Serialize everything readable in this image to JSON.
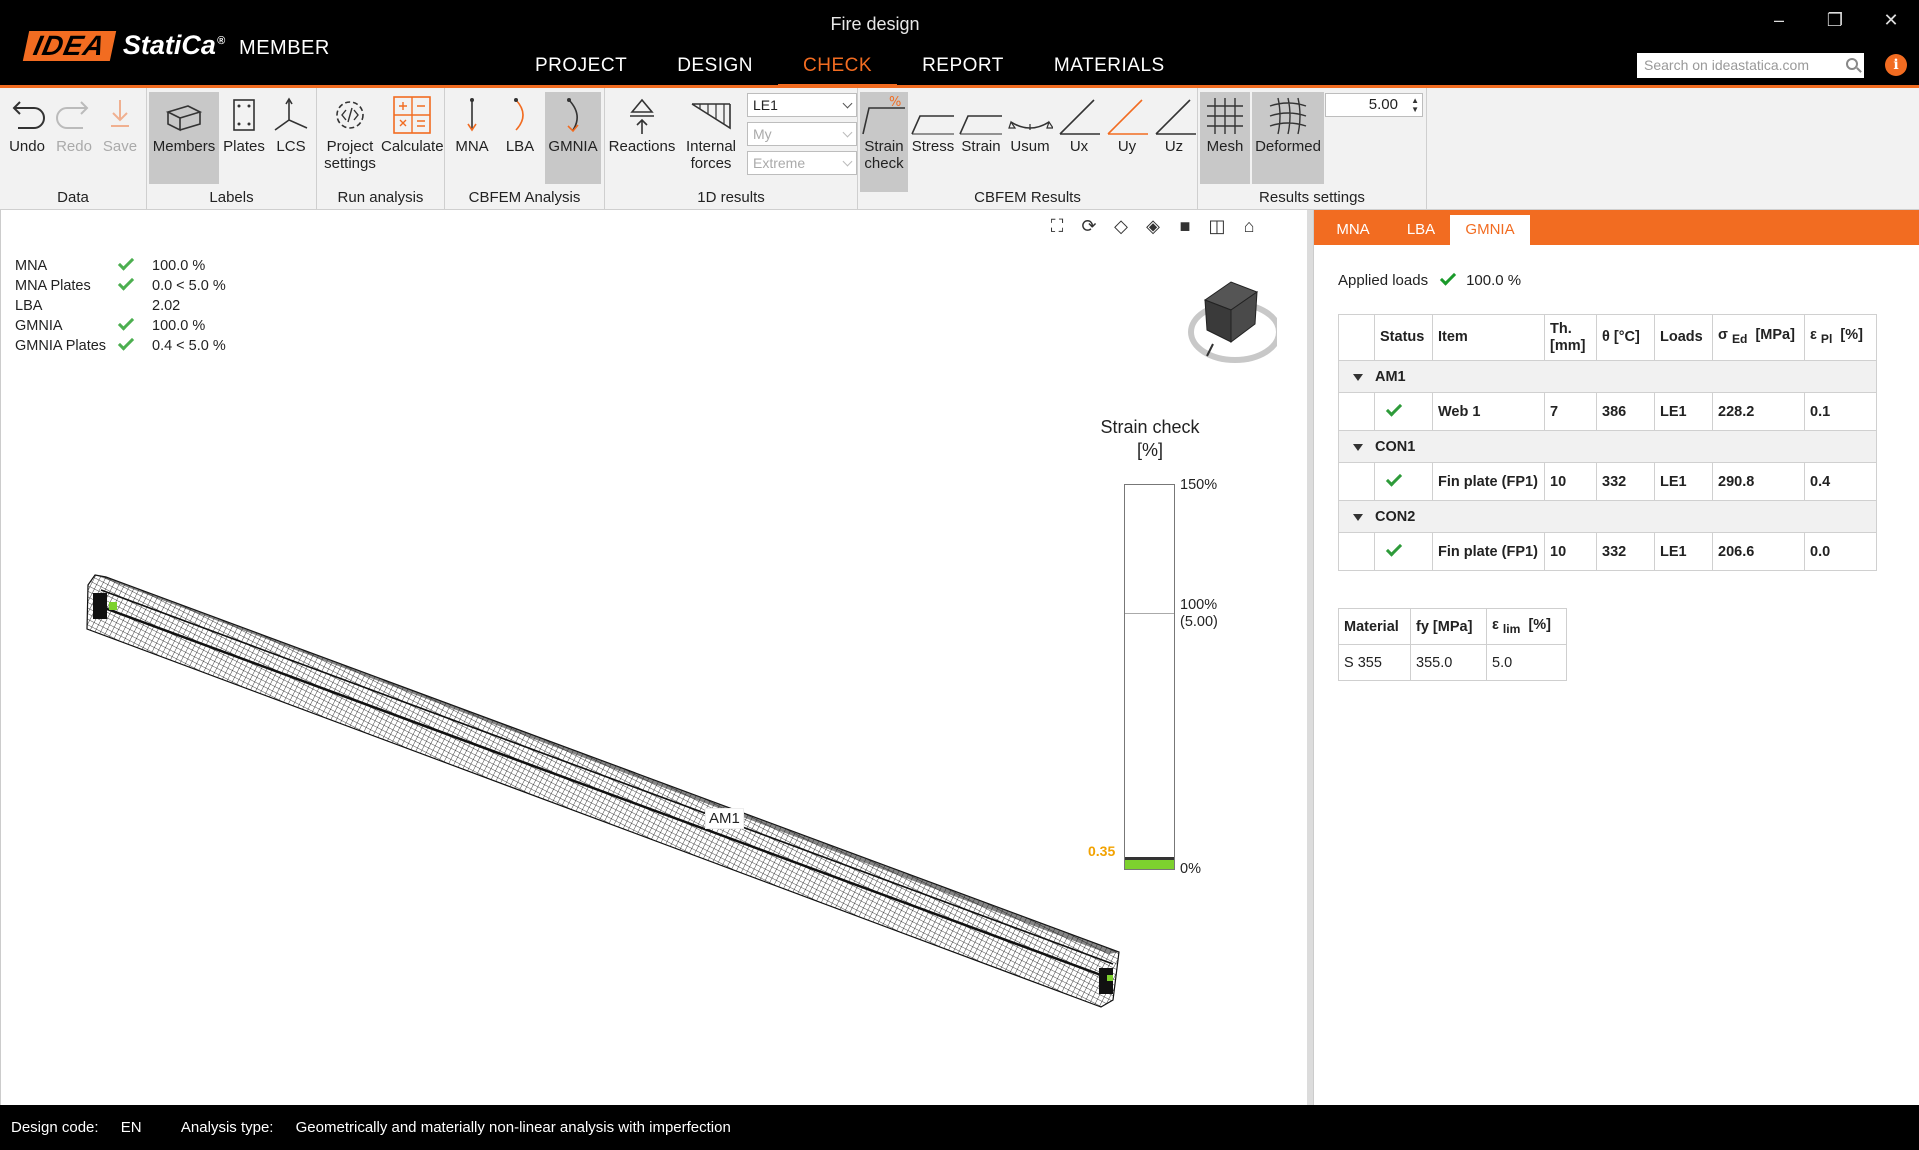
{
  "app": {
    "logo_idea": "IDEA",
    "logo_statica": "StatiCa",
    "logo_reg": "®",
    "logo_member": "MEMBER",
    "window_title": "Fire design",
    "window_controls": [
      "–",
      "❐",
      "✕"
    ]
  },
  "menu": {
    "items": [
      "PROJECT",
      "DESIGN",
      "CHECK",
      "REPORT",
      "MATERIALS"
    ],
    "active": "CHECK"
  },
  "search": {
    "placeholder": "Search on ideastatica.com"
  },
  "info_label": "i",
  "ribbon": {
    "groups": {
      "data": "Data",
      "labels": "Labels",
      "run": "Run analysis",
      "cbfem": "CBFEM Analysis",
      "results1d": "1D results",
      "cbfem_results": "CBFEM Results",
      "results_settings": "Results settings"
    },
    "buttons": {
      "undo": "Undo",
      "redo": "Redo",
      "save": "Save",
      "members": "Members",
      "plates": "Plates",
      "lcs": "LCS",
      "project_settings_1": "Project",
      "project_settings_2": "settings",
      "calculate": "Calculate",
      "mna": "MNA",
      "lba": "LBA",
      "gmnia": "GMNIA",
      "reactions": "Reactions",
      "internal_1": "Internal",
      "internal_2": "forces",
      "strain_check_1": "Strain",
      "strain_check_2": "check",
      "stress": "Stress",
      "strain": "Strain",
      "usum": "Usum",
      "ux": "Ux",
      "uy": "Uy",
      "uz": "Uz",
      "mesh": "Mesh",
      "deformed": "Deformed"
    },
    "combos": {
      "load_case": "LE1",
      "force": "My",
      "extreme": "Extreme"
    },
    "scale_value": "5.00"
  },
  "summary": [
    {
      "name": "MNA",
      "check": true,
      "value": "100.0 %"
    },
    {
      "name": "MNA Plates",
      "check": true,
      "value": "0.0 < 5.0 %"
    },
    {
      "name": "LBA",
      "check": false,
      "value": "2.02"
    },
    {
      "name": "GMNIA",
      "check": true,
      "value": "100.0 %"
    },
    {
      "name": "GMNIA Plates",
      "check": true,
      "value": "0.4 < 5.0 %"
    }
  ],
  "legend": {
    "title_1": "Strain check",
    "title_2": "[%]",
    "tick_top": "150%",
    "tick_mid_1": "100%",
    "tick_mid_2": "(5.00)",
    "tick_bottom": "0%",
    "current_value": "0.35",
    "current_fraction": 0.023
  },
  "beam": {
    "label": "AM1",
    "mesh_color": "#111111",
    "support_color": "#7dd12e"
  },
  "right_panel": {
    "tabs": [
      "MNA",
      "LBA",
      "GMNIA"
    ],
    "active_tab": "GMNIA",
    "applied_loads_label": "Applied loads",
    "applied_loads_value": "100.0 %",
    "table_headers": {
      "status": "Status",
      "item": "Item",
      "th_1": "Th.",
      "th_2": "[mm]",
      "theta": "θ  [°C]",
      "loads": "Loads",
      "sigma": "σ",
      "sigma_sub": "Ed",
      "sigma_unit": "[MPa]",
      "eps": "ε",
      "eps_sub": "Pl",
      "eps_unit": "[%]"
    },
    "groups": [
      {
        "name": "AM1",
        "row": {
          "item": "Web 1",
          "th": "7",
          "theta": "386",
          "loads": "LE1",
          "sigma": "228.2",
          "eps": "0.1"
        }
      },
      {
        "name": "CON1",
        "row": {
          "item": "Fin plate (FP1)",
          "th": "10",
          "theta": "332",
          "loads": "LE1",
          "sigma": "290.8",
          "eps": "0.4"
        }
      },
      {
        "name": "CON2",
        "row": {
          "item": "Fin plate (FP1)",
          "th": "10",
          "theta": "332",
          "loads": "LE1",
          "sigma": "206.6",
          "eps": "0.0"
        }
      }
    ],
    "material_headers": {
      "material": "Material",
      "fy": "fy [MPa]",
      "elim": "ε",
      "elim_sub": "lim",
      "elim_unit": "[%]"
    },
    "material_row": {
      "material": "S 355",
      "fy": "355.0",
      "elim": "5.0"
    }
  },
  "statusbar": {
    "design_code_label": "Design code:",
    "design_code": "EN",
    "analysis_label": "Analysis type:",
    "analysis_type": "Geometrically and materially non-linear analysis with imperfection"
  },
  "colors": {
    "accent": "#f26c21",
    "check_green": "#4caf50",
    "legend_fill": "#7dd12e",
    "value_orange": "#f2a200"
  }
}
